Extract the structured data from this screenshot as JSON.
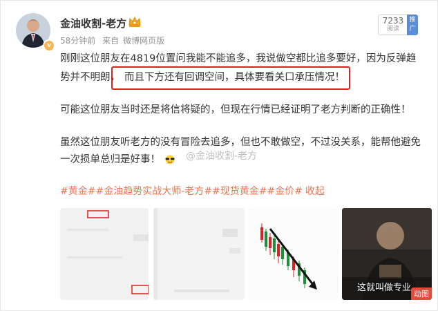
{
  "post": {
    "author_name": "金油收割-老方",
    "time": "58分钟前",
    "source_prefix": "来自",
    "source": "微博网页版",
    "fans_count": "7233",
    "fans_label": "阅读",
    "promo_label": "推广",
    "para1_line1": "刚刚这位朋友在4819位置问我能不能追多，我说做空都比追多要好，因为反弹趋",
    "para1_line2a": "势并不明朗，",
    "para1_line2b": "而且下方还有回调空间，具体要看关口承压情况！",
    "para2": "可能这位朋友当时还是将信将疑的，但现在行情已经证明了老方判断的正确性！",
    "para3_line1": "虽然这位朋友听老方的没有冒险去追多，但也不敢做空，不过没关系，能帮他避免",
    "para3_line2": "一次损单总归是好事！",
    "watermark": "@金油收割-老方",
    "tags": "#黄金##金油趋势实战大师-老方##现货黄金##金价#",
    "fav": "收起",
    "gif_label": "动图",
    "gif_subtitle": "这就叫做专业"
  },
  "colors": {
    "link": "#eb7350",
    "highlight_box": "#e02020",
    "gif_badge": "#e8493d"
  }
}
